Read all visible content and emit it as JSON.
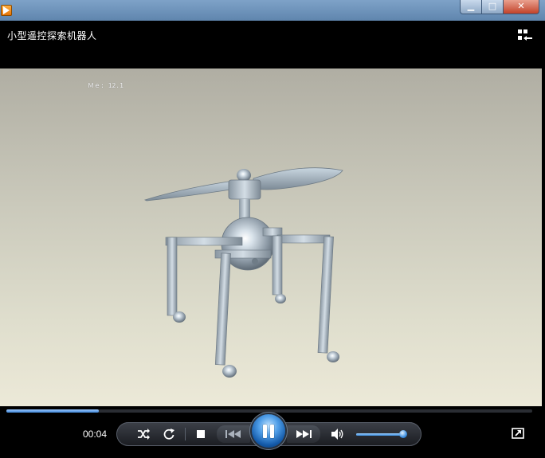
{
  "window": {
    "title": "小型遥控探索机器人",
    "minimize_label": "▁",
    "maximize_label": "□",
    "close_label": "✕"
  },
  "video": {
    "scale_label": "Ｍｅ: 12.1"
  },
  "playback": {
    "current_time": "00:04",
    "progress_fraction": 0.175,
    "volume_fraction": 0.95,
    "state": "playing"
  },
  "icons": {
    "playlist": "playlist-toggle-icon",
    "shuffle": "shuffle-icon",
    "repeat": "repeat-icon",
    "stop": "stop-icon",
    "previous": "previous-icon",
    "pause": "pause-icon",
    "next": "next-icon",
    "volume": "volume-icon",
    "fullscreen": "fullscreen-icon"
  },
  "colors": {
    "accent": "#3e86d8",
    "titlebar": "#6b8fb8",
    "background": "#000000"
  }
}
